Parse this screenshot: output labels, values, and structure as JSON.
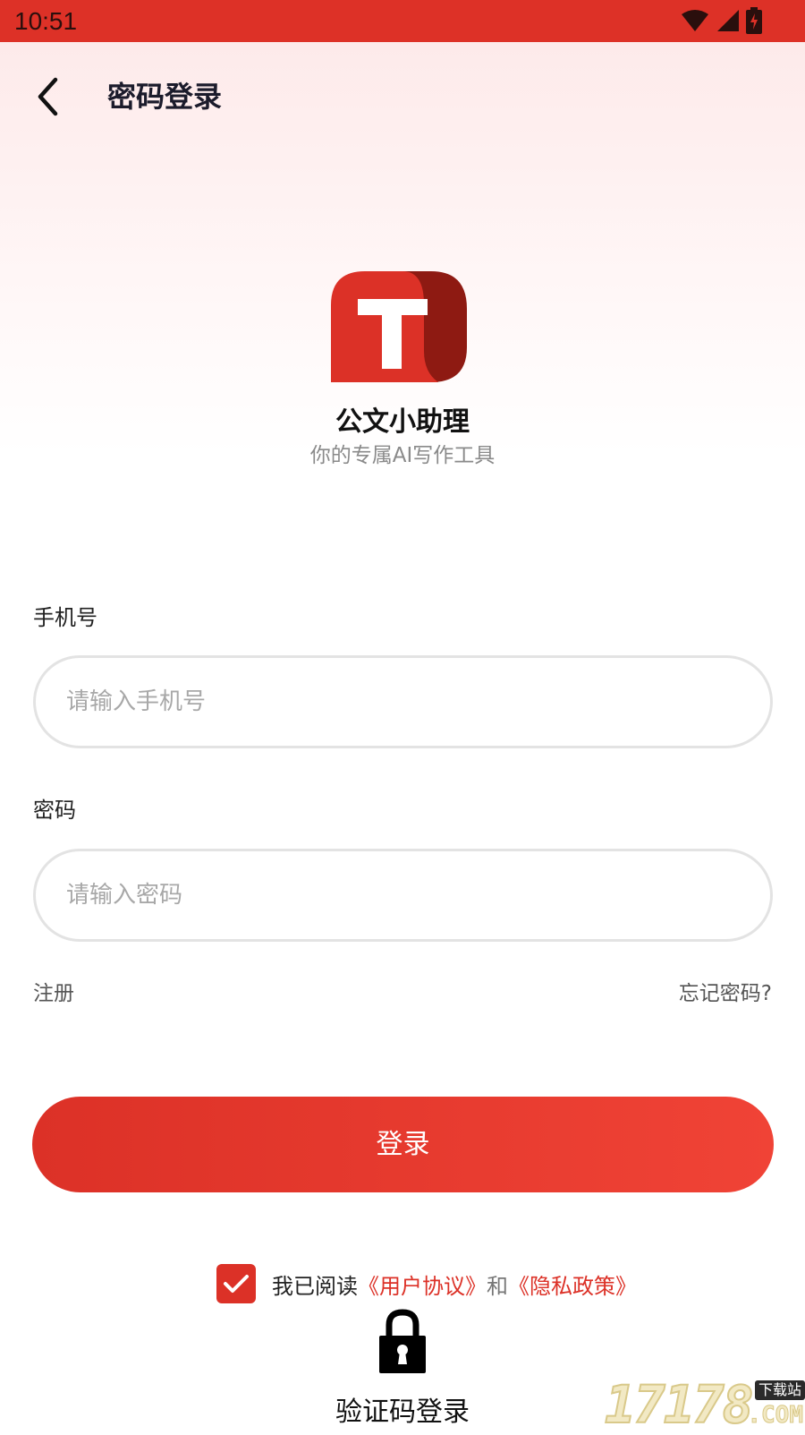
{
  "status_bar": {
    "time": "10:51",
    "icons": [
      "wifi-icon",
      "signal-icon",
      "battery-charging-icon"
    ],
    "color": "#dd3127"
  },
  "header": {
    "title": "密码登录",
    "back_icon": "chevron-left-icon"
  },
  "brand": {
    "logo_icon": "app-logo-t-icon",
    "name": "公文小助理",
    "tagline": "你的专属AI写作工具"
  },
  "form": {
    "phone": {
      "label": "手机号",
      "placeholder": "请输入手机号",
      "value": ""
    },
    "password": {
      "label": "密码",
      "placeholder": "请输入密码",
      "value": ""
    },
    "register_link": "注册",
    "forgot_link": "忘记密码?",
    "login_button": "登录"
  },
  "agreement": {
    "checked": true,
    "prefix": "我已阅读",
    "user_agreement": "《用户协议》",
    "and": "和",
    "privacy_policy": "《隐私政策》"
  },
  "alt_login": {
    "icon": "lock-icon",
    "label": "验证码登录"
  },
  "watermark": {
    "digits": "17178",
    "tag": "下载站",
    "suffix": ".COM"
  },
  "colors": {
    "accent": "#dc3127",
    "logo_dark": "#8e1a12"
  }
}
